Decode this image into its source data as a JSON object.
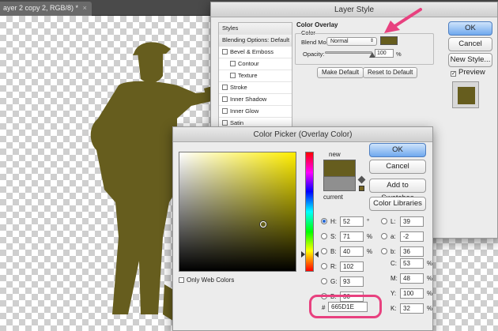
{
  "document": {
    "tab_title": "ayer 2 copy 2, RGB/8) *",
    "close_glyph": "×"
  },
  "colors": {
    "overlay": "#665D1E",
    "highlight": "#e8417f"
  },
  "layer_style": {
    "title": "Layer Style",
    "styles_header": "Styles",
    "items": [
      {
        "label": "Blending Options: Default",
        "kind": "header"
      },
      {
        "label": "Bevel & Emboss",
        "checked": false
      },
      {
        "label": "Contour",
        "checked": false,
        "sub": true
      },
      {
        "label": "Texture",
        "checked": false,
        "sub": true
      },
      {
        "label": "Stroke",
        "checked": false
      },
      {
        "label": "Inner Shadow",
        "checked": false
      },
      {
        "label": "Inner Glow",
        "checked": false
      },
      {
        "label": "Satin",
        "checked": false
      },
      {
        "label": "Color Overlay",
        "checked": true,
        "selected": true
      }
    ],
    "group_title": "Color Overlay",
    "group_sub": "Color",
    "blend_mode_label": "Blend Mode:",
    "blend_mode_value": "Normal",
    "opacity_label": "Opacity:",
    "opacity_value": "100",
    "opacity_unit": "%",
    "make_default": "Make Default",
    "reset_default": "Reset to Default",
    "ok": "OK",
    "cancel": "Cancel",
    "new_style": "New Style...",
    "preview_label": "Preview",
    "preview_checked": true
  },
  "color_picker": {
    "title": "Color Picker (Overlay Color)",
    "ok": "OK",
    "cancel": "Cancel",
    "add_swatches": "Add to Swatches",
    "color_libraries": "Color Libraries",
    "new_label": "new",
    "current_label": "current",
    "only_web": "Only Web Colors",
    "hue_position": 0.857,
    "saturation": 0.71,
    "brightness": 0.4,
    "hsb": [
      {
        "label": "H:",
        "value": "52",
        "unit": "°",
        "selected": true
      },
      {
        "label": "S:",
        "value": "71",
        "unit": "%"
      },
      {
        "label": "B:",
        "value": "40",
        "unit": "%"
      }
    ],
    "rgb": [
      {
        "label": "R:",
        "value": "102"
      },
      {
        "label": "G:",
        "value": "93"
      },
      {
        "label": "B:",
        "value": "30"
      }
    ],
    "lab": [
      {
        "label": "L:",
        "value": "39"
      },
      {
        "label": "a:",
        "value": "-2"
      },
      {
        "label": "b:",
        "value": "36"
      }
    ],
    "cmyk": [
      {
        "label": "C:",
        "value": "53",
        "unit": "%"
      },
      {
        "label": "M:",
        "value": "48",
        "unit": "%"
      },
      {
        "label": "Y:",
        "value": "100",
        "unit": "%"
      },
      {
        "label": "K:",
        "value": "32",
        "unit": "%"
      }
    ],
    "hex_label": "#",
    "hex_value": "665D1E"
  }
}
